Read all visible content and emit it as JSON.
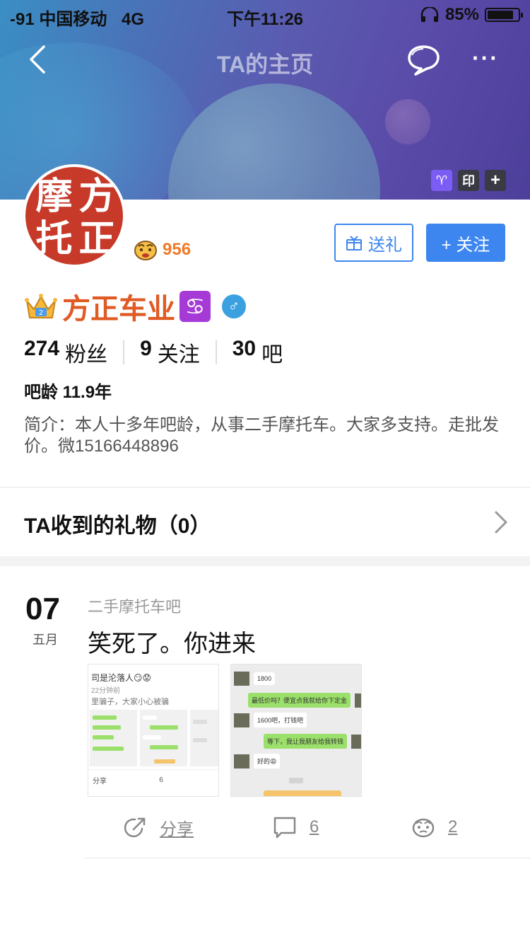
{
  "status_bar": {
    "carrier": "-91 中国移动",
    "network": "4G",
    "time": "下午11:26",
    "battery_text": "85%",
    "battery_level": 0.85
  },
  "nav": {
    "title": "TA的主页",
    "more": "···"
  },
  "banner_badges": {
    "seal": "印",
    "plus": "+"
  },
  "profile": {
    "avatar_chars": [
      "摩",
      "方",
      "托",
      "正"
    ],
    "level": "956",
    "gift_button": "送礼",
    "follow_button": "+ 关注",
    "name": "方正车业",
    "zodiac_symbol": "♋",
    "gender_symbol": "♂",
    "fans_count": "274",
    "fans_label": "粉丝",
    "following_count": "9",
    "following_label": "关注",
    "bars_count": "30",
    "bars_label": "吧",
    "bar_age": "吧龄 11.9年",
    "intro": "简介：本人十多年吧龄，从事二手摩托车。大家多支持。走批发价。微15166448896"
  },
  "gifts": {
    "title": "TA收到的礼物（0）"
  },
  "post": {
    "day": "07",
    "month": "五月",
    "forum": "二手摩托车吧",
    "title": "笑死了。你进来",
    "thumb1": {
      "line1": "司是沦落人😏😟",
      "line2": "22分钟前",
      "line3": "里骗子，大家小心被骗",
      "share": "分享",
      "comments": "6"
    },
    "thumb2": {
      "msgs": [
        "1800",
        "最低价吗？便宜点我就给你下定金",
        "1600吧，打钱吧",
        "等下，我让我朋友给我转钱",
        "好的😩"
      ]
    },
    "share_label": "分享",
    "comment_count": "6",
    "like_count": "2"
  }
}
